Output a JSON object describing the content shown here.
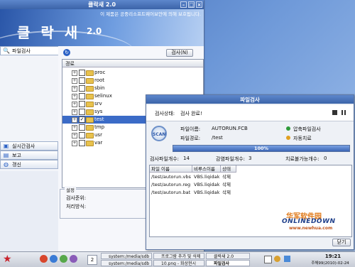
{
  "main_window": {
    "title": "클락새 2.0",
    "banner_notice": "이 제품은 공중리소프트웨어보안에 의해 보호됩니다.",
    "logo_text": "클 락 새",
    "logo_version": "2.0"
  },
  "nav": {
    "top_item": "파일검사",
    "bottom_items": [
      "실시간검사",
      "보고",
      "갱신"
    ]
  },
  "content": {
    "scan_button": "검사(N)",
    "tree_header": "경로",
    "tree_items": [
      {
        "name": "proc",
        "checked": false,
        "selected": false
      },
      {
        "name": "root",
        "checked": false,
        "selected": false
      },
      {
        "name": "sbin",
        "checked": false,
        "selected": false
      },
      {
        "name": "selinux",
        "checked": false,
        "selected": false
      },
      {
        "name": "srv",
        "checked": false,
        "selected": false
      },
      {
        "name": "sys",
        "checked": false,
        "selected": false
      },
      {
        "name": "test",
        "checked": true,
        "selected": true
      },
      {
        "name": "tmp",
        "checked": false,
        "selected": false
      },
      {
        "name": "usr",
        "checked": false,
        "selected": false
      },
      {
        "name": "var",
        "checked": false,
        "selected": false
      }
    ],
    "settings_legend": "설정",
    "settings_labels": [
      "검사준위:",
      "처리방식:"
    ]
  },
  "dialog": {
    "title": "파일검사",
    "status_label": "검사상태:",
    "status_value": "검사 완료!",
    "file_name_label": "파일이름:",
    "file_name_value": "AUTORUN.FCB",
    "file_path_label": "파일경로:",
    "file_path_value": "/test",
    "option_compressed": "압축파일검사",
    "option_auto": "자동치료",
    "progress_text": "100%",
    "progress_value": 1.0,
    "count_scanned_label": "검사파일개수:",
    "count_scanned": "14",
    "count_infected_label": "감염파일개수:",
    "count_infected": "3",
    "count_unfixable_label": "치료불가능개수:",
    "count_unfixable": "0",
    "columns": [
      "파일 이름",
      "비루스이름",
      "상태"
    ],
    "rows": [
      [
        "/test/autorun.vbs",
        "VBS.liqidak",
        "삭제"
      ],
      [
        "/test/autorun.reg",
        "VBS.liqidak",
        "삭제"
      ],
      [
        "/test/autorun.bat",
        "VBS.liqidak",
        "삭제"
      ]
    ],
    "close_button": "닫기"
  },
  "watermark": {
    "cn": "华军软件园",
    "en": "ONLINEDOWN",
    "url": "www.newhua.com"
  },
  "taskbar": {
    "workspace": "2",
    "tasks": [
      "system:/media/sdb",
      "system:/media/sdb",
      "프로그람 추가 및 삭제",
      "10.png - 화상현시",
      "클락새 2.0",
      "파일검사"
    ],
    "clock_time": "19:21",
    "clock_date": "주체99(2010)-02-24"
  },
  "colors": {
    "titlebar": "#3b63a8",
    "selection": "#3b6bc7",
    "progress": "#3a64b4",
    "option_on": "#2e9a3a",
    "option_auto": "#e0a020"
  }
}
